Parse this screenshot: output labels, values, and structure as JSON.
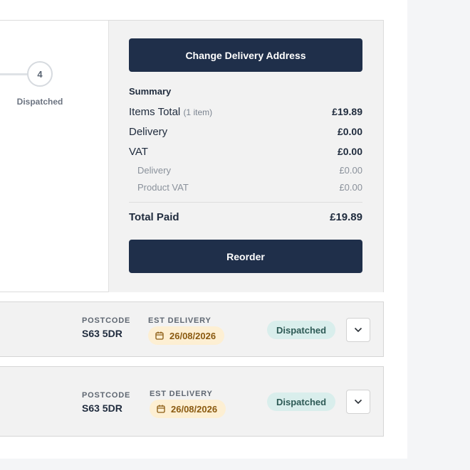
{
  "progress": {
    "step_number": "4",
    "step_label": "Dispatched"
  },
  "summary": {
    "change_address_label": "Change Delivery Address",
    "title": "Summary",
    "items_total_label": "Items Total",
    "items_count": "(1 item)",
    "items_total_value": "£19.89",
    "delivery_label": "Delivery",
    "delivery_value": "£0.00",
    "vat_label": "VAT",
    "vat_value": "£0.00",
    "vat_delivery_label": "Delivery",
    "vat_delivery_value": "£0.00",
    "vat_product_label": "Product VAT",
    "vat_product_value": "£0.00",
    "total_paid_label": "Total Paid",
    "total_paid_value": "£19.89",
    "reorder_label": "Reorder"
  },
  "shipments": [
    {
      "postcode_label": "POSTCODE",
      "postcode": "S63 5DR",
      "est_delivery_label": "EST DELIVERY",
      "est_delivery": "26/08/2026",
      "status": "Dispatched"
    },
    {
      "postcode_label": "POSTCODE",
      "postcode": "S63 5DR",
      "est_delivery_label": "EST DELIVERY",
      "est_delivery": "26/08/2026",
      "status": "Dispatched"
    }
  ],
  "colors": {
    "primary_button": "#1f2f4a",
    "date_pill_bg": "#fdefd3",
    "status_pill_bg": "#d9eeec"
  },
  "icons": {
    "calendar": "calendar-icon",
    "chevron": "chevron-down-icon"
  }
}
